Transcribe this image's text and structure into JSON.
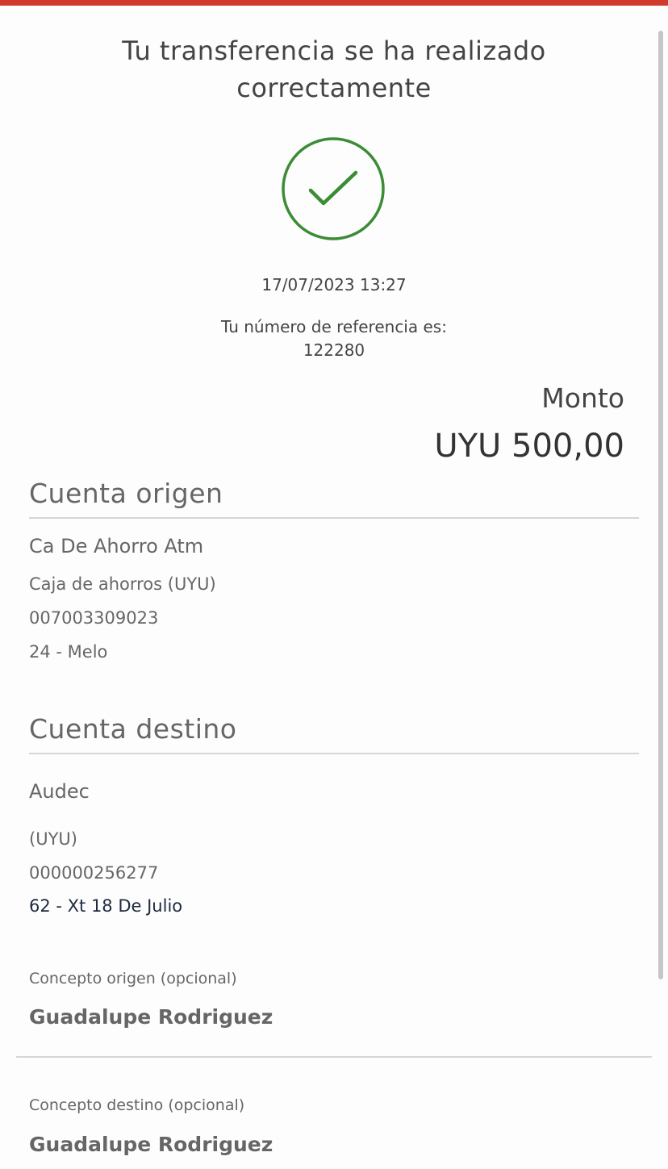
{
  "header": {
    "title_line1": "Tu transferencia se ha realizado",
    "title_line2": "correctamente"
  },
  "icons": {
    "success": "check-circle-icon"
  },
  "colors": {
    "accent_bar": "#d23a2b",
    "success": "#3b8c35"
  },
  "receipt": {
    "datetime": "17/07/2023 13:27",
    "reference_label": "Tu número de referencia es:",
    "reference_number": "122280",
    "amount_label": "Monto",
    "amount_value": "UYU 500,00"
  },
  "origin": {
    "section_title": "Cuenta origen",
    "account_name": "Ca De Ahorro Atm",
    "account_type": "Caja de ahorros (UYU)",
    "account_number": "007003309023",
    "branch": "24 - Melo"
  },
  "destination": {
    "section_title": "Cuenta destino",
    "account_name": "Audec",
    "account_type": "(UYU)",
    "account_number": "000000256277",
    "branch": "62 - Xt 18 De Julio"
  },
  "concepts": {
    "origin_label": "Concepto origen (opcional)",
    "origin_value": "Guadalupe Rodriguez",
    "destination_label": "Concepto destino (opcional)",
    "destination_value": "Guadalupe Rodriguez"
  }
}
